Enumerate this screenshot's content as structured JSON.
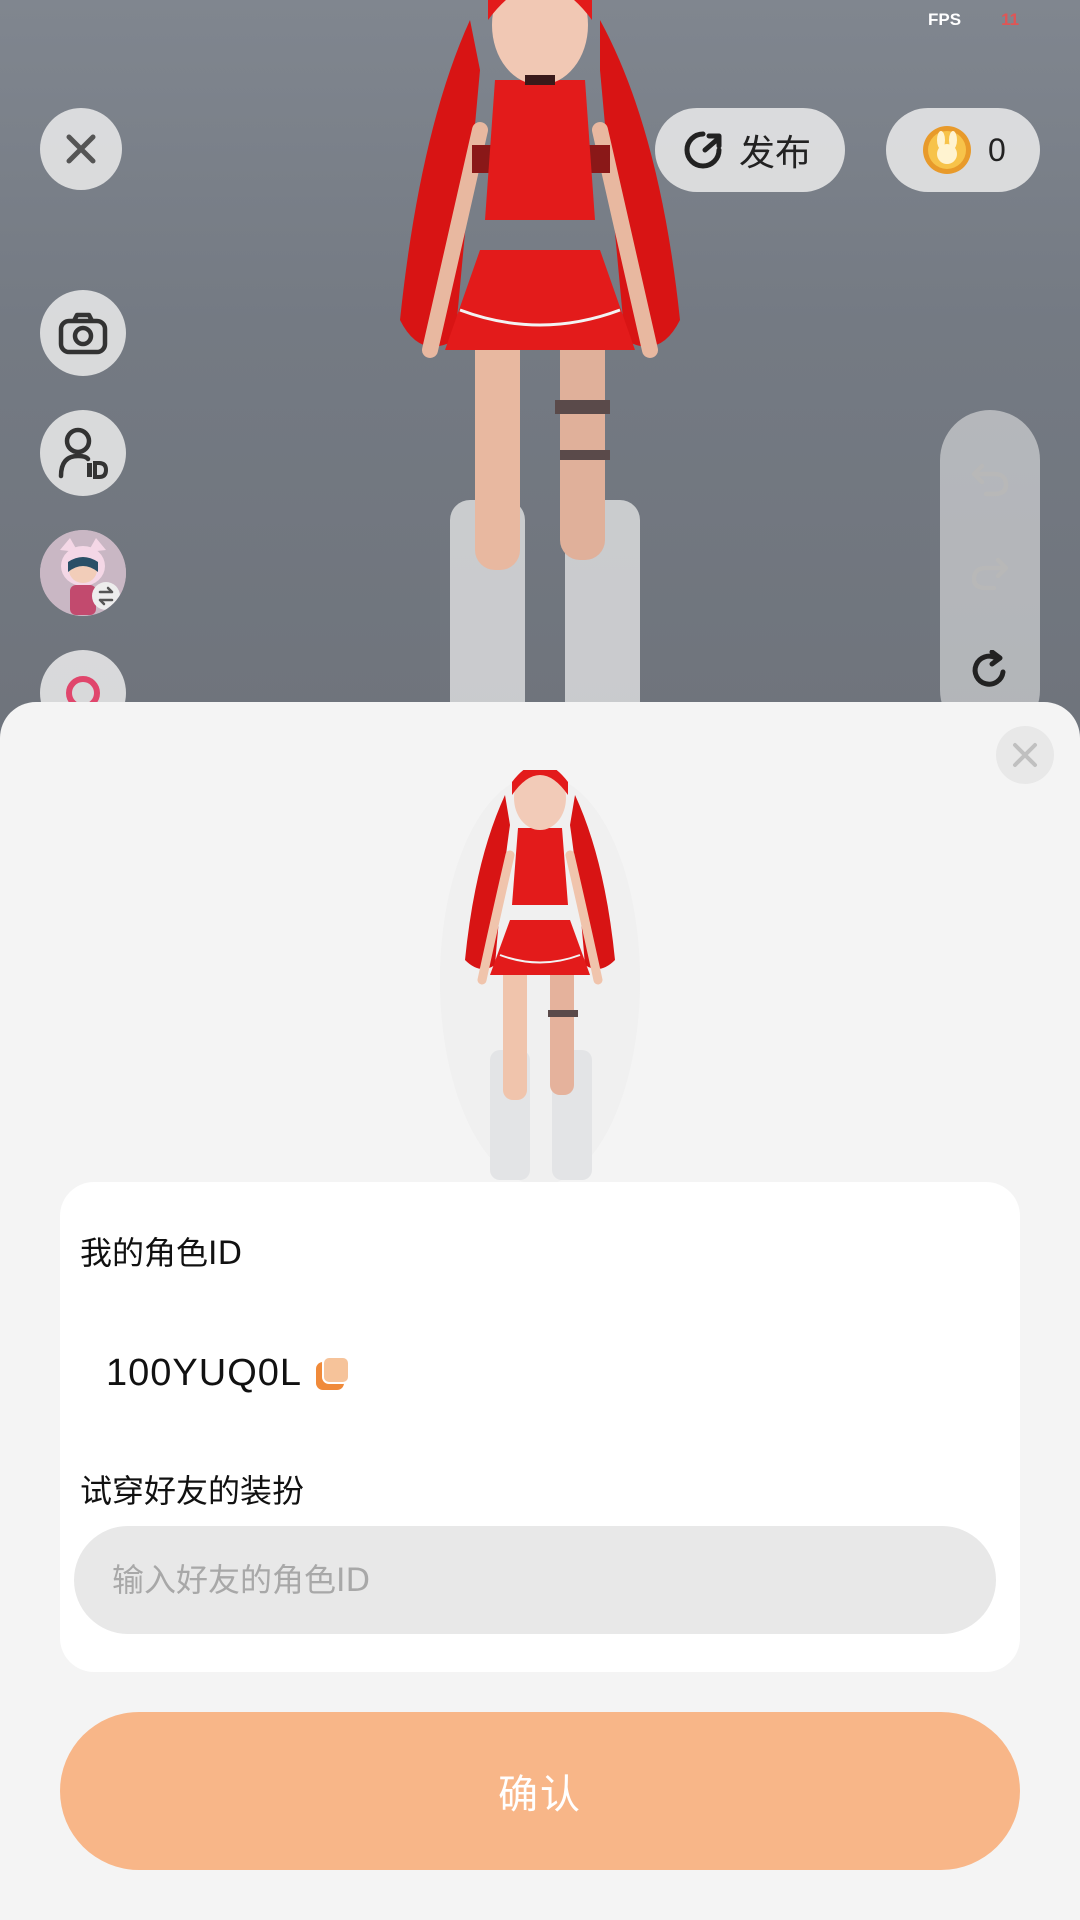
{
  "fps": {
    "label": "FPS",
    "value": "11"
  },
  "header": {
    "publish_label": "发布",
    "coin_count": "0"
  },
  "sheet": {
    "my_id_title": "我的角色ID",
    "my_id_value": "100YUQ0L",
    "try_title": "试穿好友的装扮",
    "friend_id_placeholder": "输入好友的角色ID",
    "confirm_label": "确认"
  },
  "colors": {
    "accent": "#f8b688",
    "copy_icon": "#f08a3a",
    "fps_value": "#e05555",
    "hair": "#e31b1b"
  },
  "icons": {
    "close": "close-icon",
    "publish": "refresh-arrow-icon",
    "coin": "rabbit-coin-icon",
    "camera": "camera-icon",
    "id_card": "person-id-icon",
    "undo": "undo-icon",
    "redo": "redo-icon",
    "reset": "reset-icon",
    "copy": "copy-icon"
  }
}
